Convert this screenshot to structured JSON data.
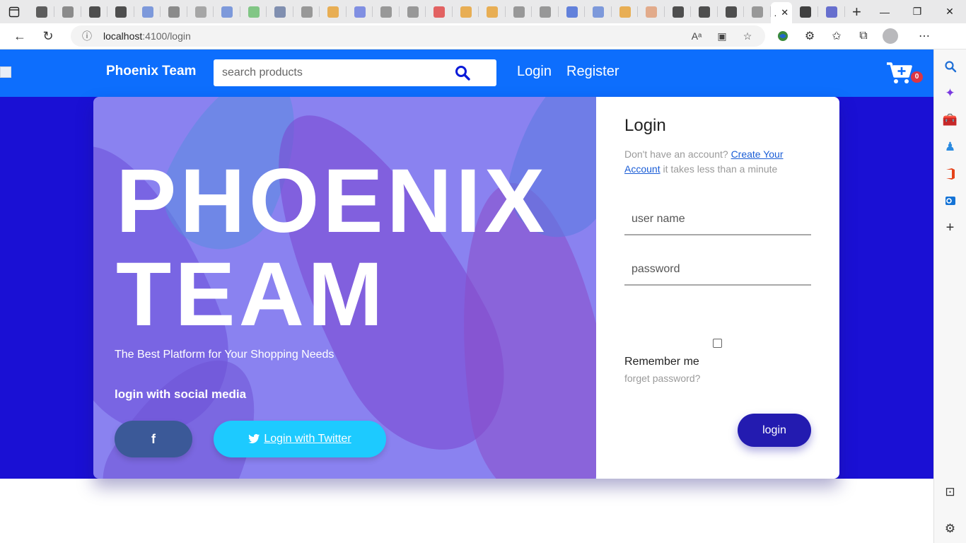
{
  "browser": {
    "tabs": [
      {
        "icon": "tab-actions-icon",
        "color": "#444444"
      },
      {
        "icon": "page-icon",
        "color": "#7a7a7a"
      },
      {
        "icon": "github-icon",
        "color": "#333333"
      },
      {
        "icon": "github-icon",
        "color": "#333333"
      },
      {
        "icon": "search-icon",
        "color": "#6a8bd8"
      },
      {
        "icon": "page-icon",
        "color": "#7a7a7a"
      },
      {
        "icon": "page-icon",
        "color": "#9a9a9a"
      },
      {
        "icon": "search-icon",
        "color": "#6a8bd8"
      },
      {
        "icon": "t-icon",
        "color": "#6fbf73"
      },
      {
        "icon": "b-icon",
        "color": "#6d7fa6"
      },
      {
        "icon": "link-icon",
        "color": "#8a8a8a"
      },
      {
        "icon": "microsoft-icon",
        "color": "#e8a33a"
      },
      {
        "icon": "image-icon",
        "color": "#6d7fe0"
      },
      {
        "icon": "doc-icon",
        "color": "#8a8a8a"
      },
      {
        "icon": "doc-icon",
        "color": "#8a8a8a"
      },
      {
        "icon": "youtube-icon",
        "color": "#e04a4a"
      },
      {
        "icon": "microsoft-icon",
        "color": "#e8a33a"
      },
      {
        "icon": "microsoft-icon",
        "color": "#e8a33a"
      },
      {
        "icon": "search-icon",
        "color": "#8a8a8a"
      },
      {
        "icon": "page-icon",
        "color": "#8a8a8a"
      },
      {
        "icon": "chat-icon",
        "color": "#4a6fd8"
      },
      {
        "icon": "search-icon",
        "color": "#6a8bd8"
      },
      {
        "icon": "microsoft-icon",
        "color": "#e8a33a"
      },
      {
        "icon": "image-icon",
        "color": "#e0a07a"
      },
      {
        "icon": "page-icon",
        "color": "#333333"
      },
      {
        "icon": "page-icon",
        "color": "#333333"
      },
      {
        "icon": "page-icon",
        "color": "#333333"
      },
      {
        "icon": "page-icon",
        "color": "#8a8a8a"
      }
    ],
    "active_tab_label": ".",
    "extra_tabs": [
      {
        "icon": "angular-icon",
        "color": "#222222"
      },
      {
        "icon": "teams-icon",
        "color": "#5059c9"
      }
    ],
    "url_host": "localhost",
    "url_path": ":4100/login"
  },
  "navbar": {
    "brand": "Phoenix Team",
    "search_placeholder": "search products",
    "links": [
      "Login",
      "Register"
    ],
    "cart_count": "0",
    "color": "#0d6efd"
  },
  "hero": {
    "title": "PHOENIX\nTEAM",
    "tagline": "The Best Platform for Your Shopping Needs",
    "social_heading": "login with social media",
    "facebook_label": "f",
    "twitter_label": "Login with Twitter"
  },
  "login": {
    "title": "Login",
    "signup_prefix": "Don't have an account?",
    "signup_link": "Create Your Account",
    "signup_suffix": "it takes less than a minute",
    "username_placeholder": "user name",
    "password_placeholder": "password",
    "remember_label": "Remember me",
    "forgot_label": "forget password?",
    "submit_label": "login"
  },
  "colors": {
    "page_bg": "#1a10d4",
    "hero_panel": "#8a82f0",
    "login_button": "#231bb0",
    "twitter": "#1dcaff",
    "facebook": "#3b5998"
  }
}
